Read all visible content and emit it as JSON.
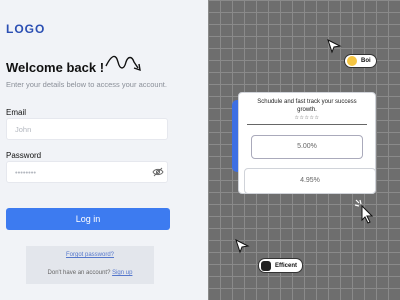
{
  "login": {
    "logo": "LOGO",
    "welcome": "Welcome back !",
    "subtitle": "Enter your details below to access your account.",
    "email_label": "Email",
    "email_placeholder": "John",
    "password_label": "Password",
    "password_placeholder": "••••••••",
    "login_button": "Log in",
    "forgot": "Forgot password?",
    "no_account": "Don't have an account?",
    "signup": "Sign up"
  },
  "preview": {
    "card_title": "Schudule and fast track your success growth.",
    "stars": "☆☆☆☆☆",
    "option1": "5.00%",
    "option2": "4.95%",
    "badge_boi": "Boi",
    "badge_efficent": "Efficent"
  },
  "colors": {
    "accent": "#3d7bf0",
    "brand": "#2b4fb3",
    "grid_bg": "#6e6e6e"
  }
}
